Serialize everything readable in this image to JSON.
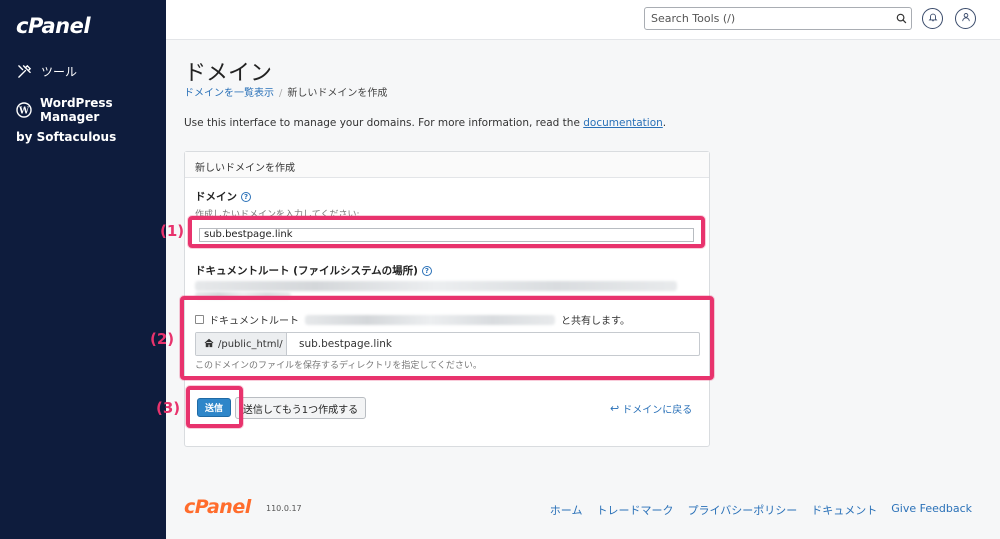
{
  "sidebar": {
    "logo": "cPanel",
    "items": [
      {
        "label": "ツール",
        "icon": "tools-icon"
      },
      {
        "label_line1": "WordPress Manager",
        "label_line2": "by Softaculous",
        "icon": "wordpress-icon"
      }
    ]
  },
  "topbar": {
    "search_placeholder": "Search Tools (/)",
    "icons": [
      "search-icon",
      "bell-icon",
      "user-icon"
    ]
  },
  "page": {
    "title": "ドメイン",
    "breadcrumb_parent": "ドメインを一覧表示",
    "breadcrumb_sep": "/",
    "breadcrumb_current": "新しいドメインを作成",
    "intro_text": "Use this interface to manage your domains. For more information, read the ",
    "intro_link": "documentation",
    "intro_end": "."
  },
  "form": {
    "panel_title": "新しいドメインを作成",
    "domain_label": "ドメイン",
    "domain_help": "作成したいドメインを入力してください:",
    "domain_value": "sub.bestpage.link",
    "docroot_label": "ドキュメントルート (ファイルシステムの場所)",
    "share_prefix": "ドキュメントルート",
    "share_suffix": "と共有します。",
    "path_prefix": "/public_html/",
    "path_value": "sub.bestpage.link",
    "path_help": "このドメインのファイルを保存するディレクトリを指定してください。",
    "submit_label": "送信",
    "submit_another_label": "送信してもう1つ作成する",
    "back_label": "ドメインに戻る"
  },
  "annotations": {
    "one": "(1)",
    "two": "(2)",
    "three": "(3)",
    "color": "#e8336d"
  },
  "footer": {
    "logo": "cPanel",
    "version": "110.0.17",
    "links": [
      "ホーム",
      "トレードマーク",
      "プライバシーポリシー",
      "ドキュメント",
      "Give Feedback"
    ]
  },
  "colors": {
    "sidebar_bg": "#0e1c3d",
    "accent": "#2a71b8",
    "brand_orange": "#ff6c2c"
  }
}
